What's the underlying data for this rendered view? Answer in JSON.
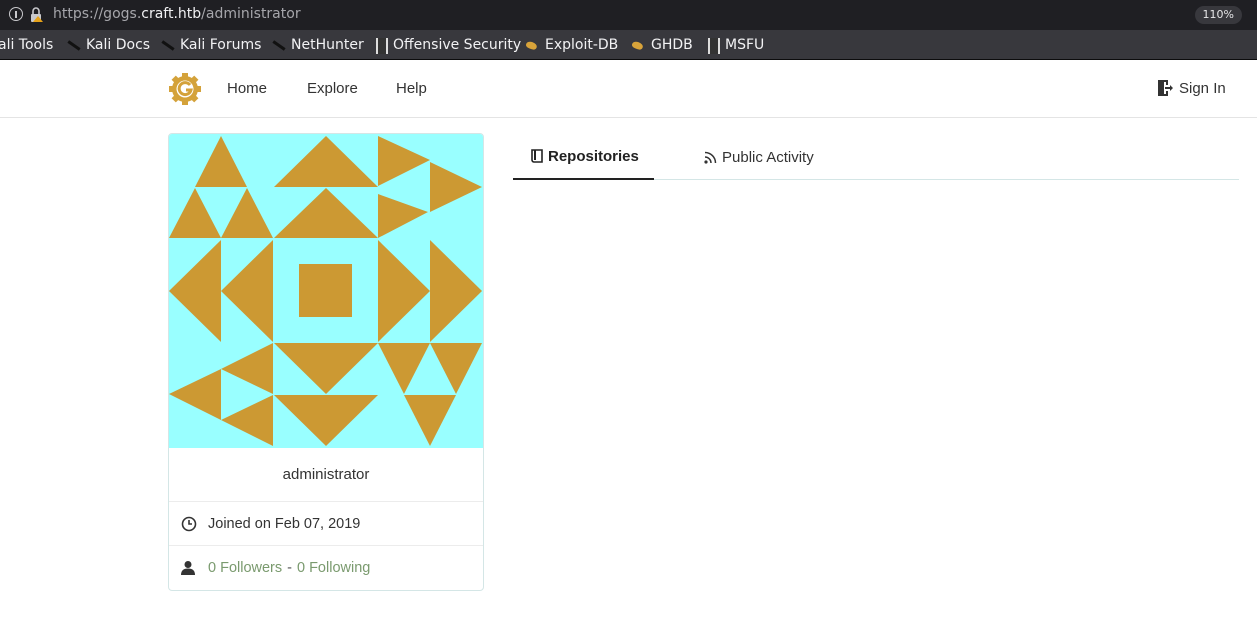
{
  "browser": {
    "url_prefix": "https://gogs.",
    "url_host": "craft.htb",
    "url_path": "/administrator",
    "zoom": "110%"
  },
  "bookmarks": [
    {
      "label": "ali Tools",
      "icon": "kali-dragon-icon"
    },
    {
      "label": "Kali Docs",
      "icon": "kali-dragon-icon"
    },
    {
      "label": "Kali Forums",
      "icon": "kali-dragon-icon"
    },
    {
      "label": "NetHunter",
      "icon": "kali-dragon-icon"
    },
    {
      "label": "Offensive Security",
      "icon": "offsec-icon"
    },
    {
      "label": "Exploit-DB",
      "icon": "exploitdb-icon"
    },
    {
      "label": "GHDB",
      "icon": "exploitdb-icon"
    },
    {
      "label": "MSFU",
      "icon": "offsec-icon"
    }
  ],
  "navbar": {
    "home": "Home",
    "explore": "Explore",
    "help": "Help",
    "sign_in": "Sign In"
  },
  "profile": {
    "username": "administrator",
    "joined": "Joined on Feb 07, 2019",
    "followers": "0 Followers",
    "separator": "-",
    "following": "0 Following"
  },
  "tabs": {
    "repositories": "Repositories",
    "public_activity": "Public Activity"
  },
  "colors": {
    "avatar_bg": "#99ffff",
    "avatar_fg": "#cc9933",
    "link": "#7a9a6e"
  }
}
